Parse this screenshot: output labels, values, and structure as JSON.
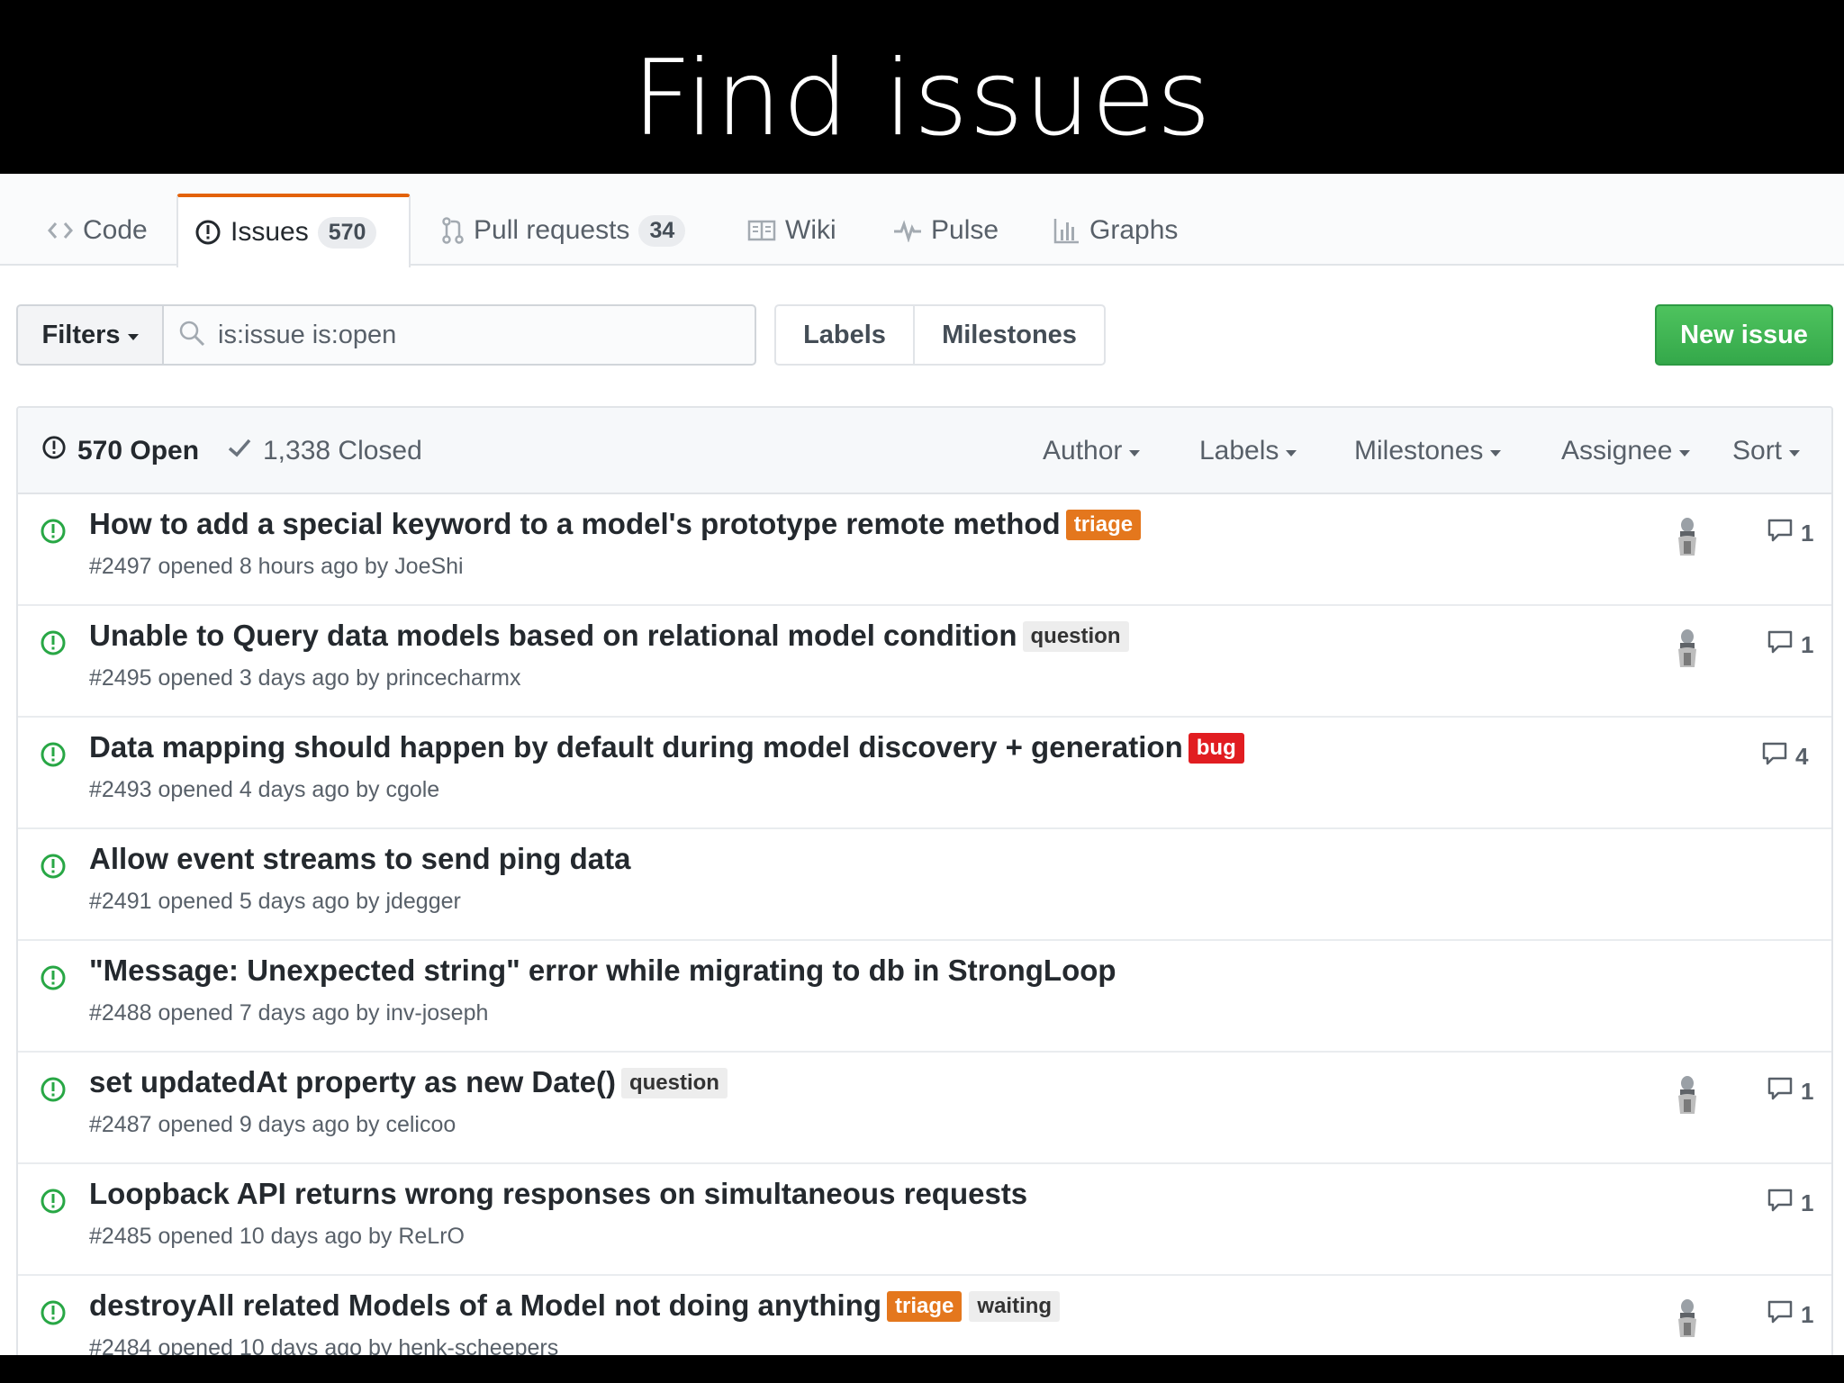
{
  "slide": {
    "title": "Find issues"
  },
  "tabs": [
    {
      "label": "Code",
      "icon": "code-icon"
    },
    {
      "label": "Issues",
      "counter": "570",
      "icon": "issue-opened-icon",
      "selected": true
    },
    {
      "label": "Pull requests",
      "counter": "34",
      "icon": "git-pull-request-icon"
    },
    {
      "label": "Wiki",
      "icon": "book-icon"
    },
    {
      "label": "Pulse",
      "icon": "pulse-icon"
    },
    {
      "label": "Graphs",
      "icon": "graph-icon"
    }
  ],
  "toolbar": {
    "filters_label": "Filters",
    "search_value": "is:issue is:open",
    "labels_label": "Labels",
    "milestones_label": "Milestones",
    "new_issue_label": "New issue"
  },
  "list_header": {
    "open_label": "570 Open",
    "closed_label": "1,338 Closed",
    "filters": [
      "Author",
      "Labels",
      "Milestones",
      "Assignee",
      "Sort"
    ]
  },
  "issues": [
    {
      "title": "How to add a special keyword to a model's prototype remote method",
      "meta": "#2497 opened 8 hours ago by JoeShi",
      "labels": [
        "triage"
      ],
      "has_assignee": true,
      "comments": "1"
    },
    {
      "title": "Unable to Query data models based on relational model condition",
      "meta": "#2495 opened 3 days ago by princecharmx",
      "labels": [
        "question"
      ],
      "has_assignee": true,
      "comments": "1"
    },
    {
      "title": "Data mapping should happen by default during model discovery + generation",
      "meta": "#2493 opened 4 days ago by cgole",
      "labels": [
        "bug"
      ],
      "has_assignee": false,
      "comments": "4"
    },
    {
      "title": "Allow event streams to send ping data",
      "meta": "#2491 opened 5 days ago by jdegger",
      "labels": [],
      "has_assignee": false,
      "comments": ""
    },
    {
      "title": "\"Message: Unexpected string\" error while migrating to db in StrongLoop",
      "meta": "#2488 opened 7 days ago by inv-joseph",
      "labels": [],
      "has_assignee": false,
      "comments": ""
    },
    {
      "title": "set updatedAt property as new Date()",
      "meta": "#2487 opened 9 days ago by celicoo",
      "labels": [
        "question"
      ],
      "has_assignee": true,
      "comments": "1"
    },
    {
      "title": "Loopback API returns wrong responses on simultaneous requests",
      "meta": "#2485 opened 10 days ago by ReLrO",
      "labels": [],
      "has_assignee": false,
      "comments": "1"
    },
    {
      "title": "destroyAll related Models of a Model not doing anything",
      "meta": "#2484 opened 10 days ago by henk-scheepers",
      "labels": [
        "triage",
        "waiting"
      ],
      "has_assignee": true,
      "comments": "1"
    }
  ],
  "label_colors": {
    "triage": {
      "bg": "#e4771d",
      "fg": "#ffffff"
    },
    "question": {
      "bg": "#ededed",
      "fg": "#333333"
    },
    "bug": {
      "bg": "#e11d21",
      "fg": "#ffffff"
    },
    "waiting": {
      "bg": "#ededed",
      "fg": "#333333"
    }
  },
  "colors": {
    "open_icon": "#28a745",
    "new_issue_button": "#34a84a",
    "selected_tab_accent": "#e36209"
  }
}
